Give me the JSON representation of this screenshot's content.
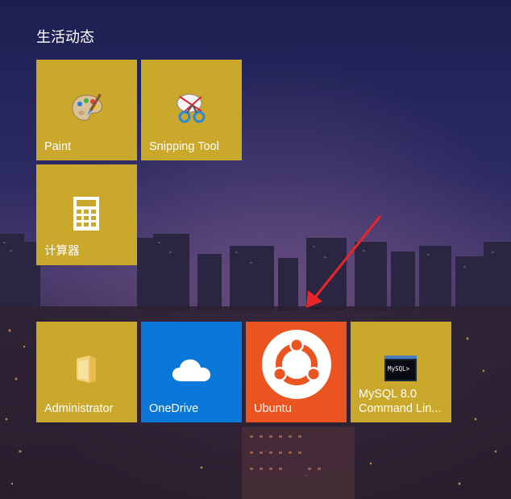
{
  "group": {
    "title": "生活动态"
  },
  "tiles": [
    {
      "label": "Paint",
      "icon": "paint-palette-icon"
    },
    {
      "label": "Snipping Tool",
      "icon": "scissors-icon"
    },
    {
      "label": "计算器",
      "icon": "calculator-icon"
    },
    {
      "label": "Administrator",
      "icon": "folder-icon"
    },
    {
      "label": "OneDrive",
      "icon": "cloud-icon"
    },
    {
      "label": "Ubuntu",
      "icon": "ubuntu-logo-icon"
    },
    {
      "label": "MySQL 8.0\nCommand Lin...",
      "icon": "mysql-console-icon"
    }
  ],
  "mysql_icon_text": "MySQL>",
  "colors": {
    "tile_gold": "#c9a82c",
    "tile_blue": "#0a78d8",
    "tile_orange": "#e95420",
    "arrow_red": "#e8262a"
  }
}
